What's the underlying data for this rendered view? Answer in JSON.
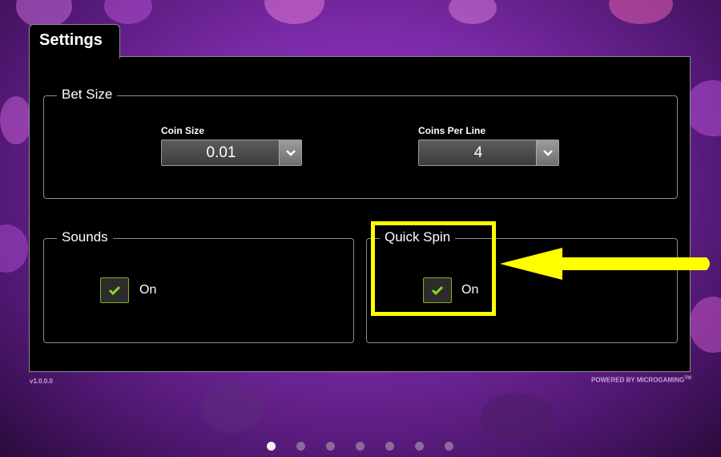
{
  "settings": {
    "tab_title": "Settings",
    "bet_size": {
      "title": "Bet Size",
      "coin_size": {
        "label": "Coin Size",
        "value": "0.01"
      },
      "coins_per_line": {
        "label": "Coins Per Line",
        "value": "4"
      }
    },
    "sounds": {
      "title": "Sounds",
      "option_label": "On",
      "checked": true
    },
    "quick_spin": {
      "title": "Quick Spin",
      "option_label": "On",
      "checked": true
    }
  },
  "footer": {
    "version": "v1.0.0.0",
    "powered_by": "POWERED BY MICROGAMING",
    "trademark": "TM"
  },
  "pagination": {
    "total": 7,
    "active_index": 0
  },
  "annotation": {
    "highlight_color": "#ffff00",
    "arrow_color": "#ffff00"
  },
  "colors": {
    "check_green": "#7fb51f",
    "panel_bg": "#000000"
  }
}
